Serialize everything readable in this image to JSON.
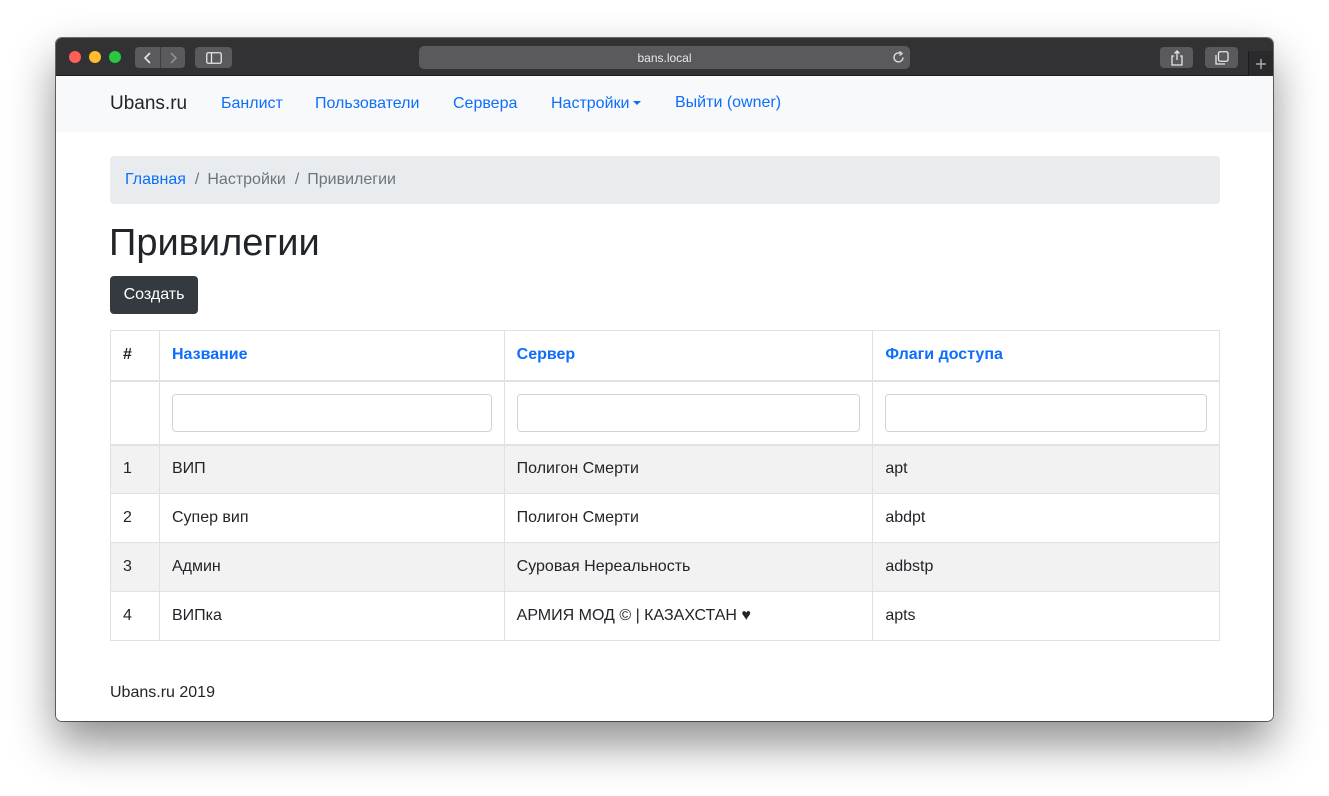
{
  "browser": {
    "url": "bans.local"
  },
  "navbar": {
    "brand": "Ubans.ru",
    "links": [
      "Банлист",
      "Пользователи",
      "Сервера",
      "Настройки",
      "Выйти (owner)"
    ]
  },
  "breadcrumb": {
    "items": [
      "Главная",
      "Настройки",
      "Привилегии"
    ],
    "separator": "/"
  },
  "main": {
    "title": "Привилегии",
    "create_label": "Создать"
  },
  "table": {
    "columns": [
      "#",
      "Название",
      "Сервер",
      "Флаги доступа"
    ],
    "filters": [
      "",
      "",
      ""
    ],
    "rows": [
      [
        "1",
        "ВИП",
        "Полигон Смерти",
        "apt"
      ],
      [
        "2",
        "Супер вип",
        "Полигон Смерти",
        "abdpt"
      ],
      [
        "3",
        "Админ",
        "Суровая Нереальность",
        "adbstp"
      ],
      [
        "4",
        "ВИПка",
        "АРМИЯ МОД © | КАЗАХСТАН ♥",
        "apts"
      ]
    ]
  },
  "footer": {
    "text": "Ubans.ru 2019"
  },
  "colors": {
    "link": "#0d6efd",
    "navbar_bg": "#f8f9fa",
    "breadcrumb_bg": "#e9ecef",
    "dark_button": "#343a40"
  }
}
